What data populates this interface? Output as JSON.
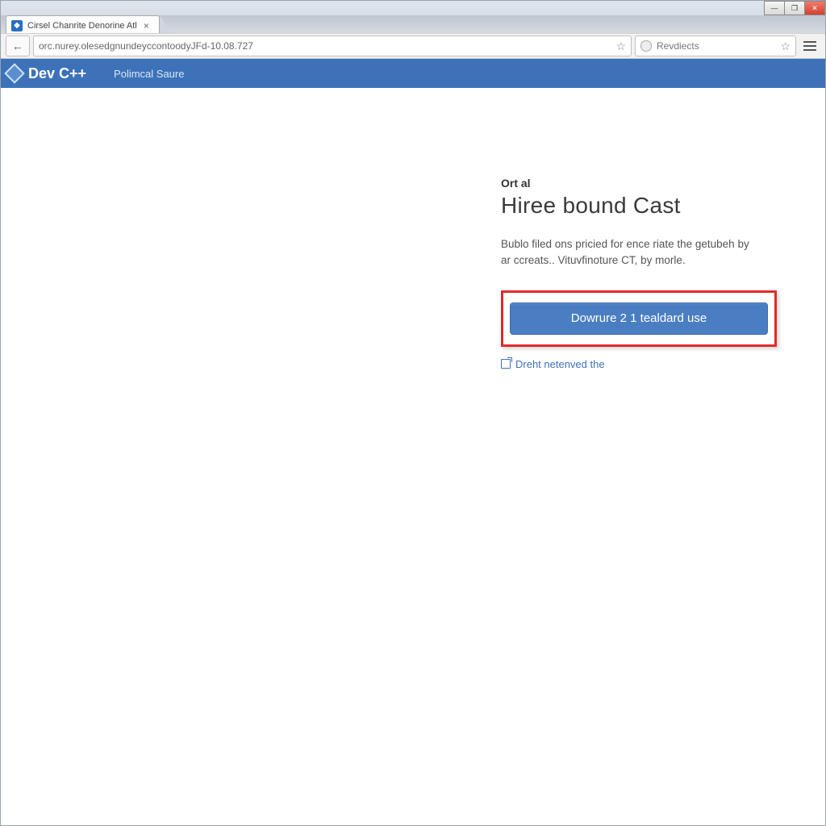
{
  "window": {
    "tab_title": "Cirsel Chanrite Denorine Atl",
    "minimize_glyph": "—",
    "maximize_glyph": "❐",
    "close_glyph": "✕"
  },
  "address_bar": {
    "back_glyph": "←",
    "url": "orc.nurey.olesedgnundeyccontoodyJFd-10.08.727",
    "star_glyph": "☆"
  },
  "secondary_box": {
    "label": "Revdiects",
    "star_glyph": "☆"
  },
  "site_nav": {
    "brand": "Dev C++",
    "link1": "Polimcal Saure"
  },
  "page": {
    "kicker": "Ort al",
    "headline": "Hiree bound Cast",
    "blurb": "Bublo filed ons pricied for ence riate the getubeh by ar ccreats.. Vituvfinoture CT, by morle.",
    "cta_label": "Dowrure 2 1 tealdard use",
    "secondary_link": "Dreht netenved the"
  }
}
